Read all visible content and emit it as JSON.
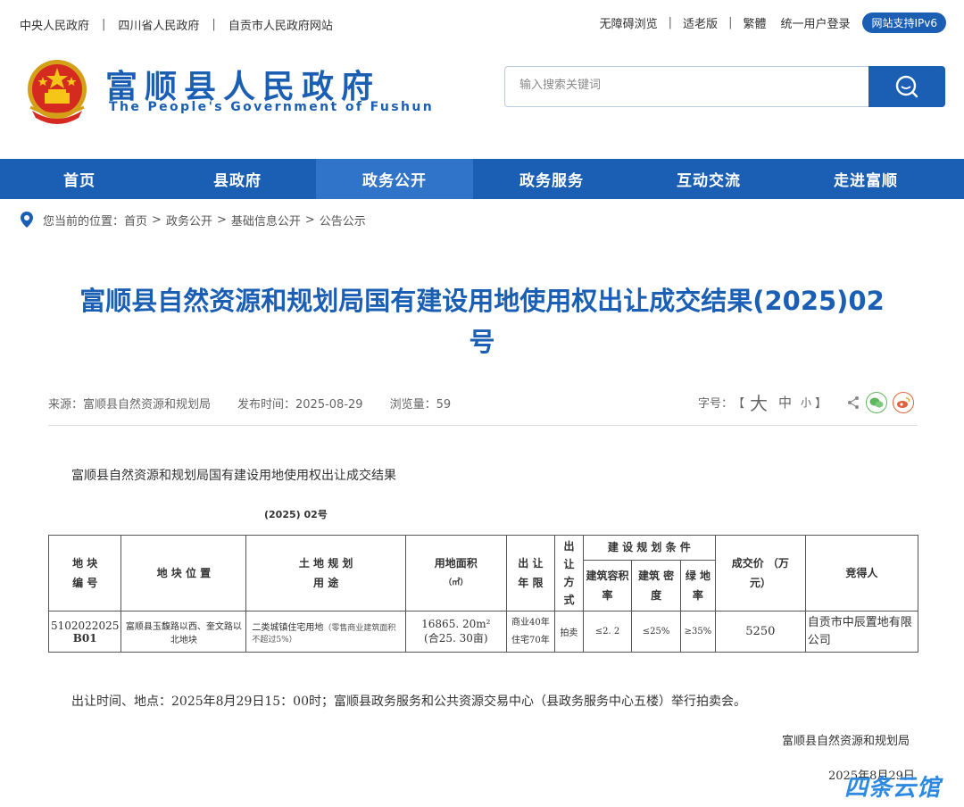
{
  "topbar": {
    "links": [
      "中央人民政府",
      "四川省人民政府",
      "自贡市人民政府网站"
    ],
    "right_links": [
      "无障碍浏览",
      "适老版",
      "繁體",
      "统一用户登录"
    ],
    "ipv6": "网站支持IPv6"
  },
  "header": {
    "title": "富顺县人民政府",
    "subtitle": "The People's Government of Fushun",
    "search_placeholder": "输入搜索关键词"
  },
  "nav": [
    "首页",
    "县政府",
    "政务公开",
    "政务服务",
    "互动交流",
    "走进富顺"
  ],
  "breadcrumb": {
    "prefix": "您当前的位置：",
    "items": [
      "首页",
      "政务公开",
      "基础信息公开",
      "公告公示"
    ]
  },
  "article": {
    "title_line1": "富顺县自然资源和规划局国有建设用地使用权出让成交结果(2025)02",
    "title_line2": "号",
    "source": "来源：富顺县自然资源和规划局",
    "date": "发布时间：2025-08-29",
    "views": "浏览量：59",
    "fontsize_label": "字号：",
    "fs_big": "大",
    "fs_mid": "中",
    "fs_small": "小",
    "bracket_l": "【",
    "bracket_r": "】",
    "p1": "富顺县自然资源和规划局国有建设用地使用权出让成交结果",
    "p2": "(2025) 02号",
    "p3": "出让时间、地点：2025年8月29日15：00时；富顺县政务服务和公共资源交易中心（县政务服务中心五楼）举行拍卖会。",
    "p4": "富顺县自然资源和规划局",
    "p5": "2025年8月29日"
  },
  "table": {
    "h_plot_no_1": "地 块",
    "h_plot_no_2": "编 号",
    "h_location": "地 块 位 置",
    "h_use_1": "土 地 规 划",
    "h_use_2": "用 途",
    "h_area_1": "用地面积",
    "h_area_2": "（㎡）",
    "h_term_1": "出 让",
    "h_term_2": "年 限",
    "h_method_1": "出",
    "h_method_2": "让",
    "h_method_3": "方",
    "h_method_4": "式",
    "h_conditions": "建 设 规 划 条 件",
    "h_far_1": "建筑容积",
    "h_far_2": "率",
    "h_density_1": "建筑 密",
    "h_density_2": "度",
    "h_green_1": "绿  地",
    "h_green_2": "率",
    "h_price_1": "成交价      （万",
    "h_price_2": "元）",
    "h_winner": "竞得人",
    "row": {
      "plot_no_1": "5102022025",
      "plot_no_2": "B01",
      "location": "富顺县玉馥路以西、奎文路以北地块",
      "use_main": "二类城镇住宅用地",
      "use_note": "（零售商业建筑面积不超过5%）",
      "area_1": "16865. 20m²",
      "area_2": "(合25. 30亩)",
      "term_1": "商业40年",
      "term_2": "住宅70年",
      "method": "拍卖",
      "far": "≤2. 2",
      "density": "≤25%",
      "green": "≥35%",
      "price": "5250",
      "winner": "自贡市中辰置地有限公司"
    }
  },
  "watermark": "四条云馆",
  "colors": {
    "primary": "#1a5fb4",
    "nav_active": "#2f74c8"
  }
}
